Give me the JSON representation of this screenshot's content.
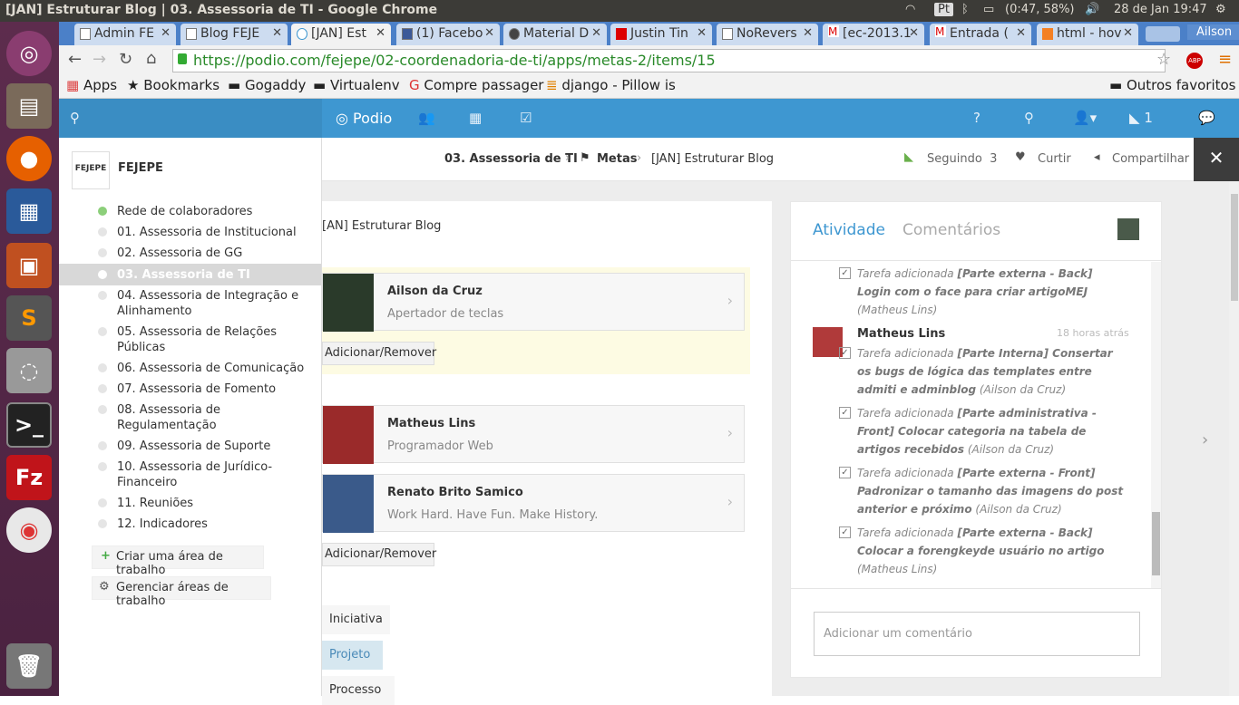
{
  "os": {
    "window_title": "[JAN] Estruturar Blog | 03. Assessoria de TI - Google Chrome",
    "keyboard": "Pt",
    "battery": "(0:47, 58%)",
    "datetime": "28 de Jan 19:47",
    "user": "Ailson"
  },
  "tabs": [
    {
      "label": "Admin FE"
    },
    {
      "label": "Blog FEJE"
    },
    {
      "label": "[JAN] Est"
    },
    {
      "label": "(1) Facebo"
    },
    {
      "label": "Material D"
    },
    {
      "label": "Justin Tin"
    },
    {
      "label": "NoRevers"
    },
    {
      "label": "[ec-2013.1"
    },
    {
      "label": "Entrada ("
    },
    {
      "label": "html - hov"
    }
  ],
  "tab_user": "Ailson",
  "url": "https://podio.com/fejepe/02-coordenadoria-de-ti/apps/metas-2/items/15",
  "bookmarks": [
    {
      "label": "Apps"
    },
    {
      "label": "Bookmarks"
    },
    {
      "label": "Gogaddy"
    },
    {
      "label": "Virtualenv"
    },
    {
      "label": "Compre passager"
    },
    {
      "label": "django - Pillow is"
    }
  ],
  "bookmarks_other": "Outros favoritos",
  "podio": {
    "logo": "Podio",
    "notif_count": "1"
  },
  "sidebar": {
    "org_logo": "FEJEPE",
    "org_name": "FEJEPE",
    "items": [
      {
        "label": "Rede de colaboradores"
      },
      {
        "label": "01. Assessoria de Institucional"
      },
      {
        "label": "02. Assessoria de GG"
      },
      {
        "label": "03. Assessoria de TI"
      },
      {
        "label": "04. Assessoria de Integração e Alinhamento"
      },
      {
        "label": "05. Assessoria de Relações Públicas"
      },
      {
        "label": "06. Assessoria de Comunicação"
      },
      {
        "label": "07. Assessoria de Fomento"
      },
      {
        "label": "08. Assessoria de Regulamentação"
      },
      {
        "label": "09. Assessoria de Suporte"
      },
      {
        "label": "10. Assessoria de Jurídico-Financeiro"
      },
      {
        "label": "11. Reuniões"
      },
      {
        "label": "12. Indicadores"
      }
    ],
    "create_workspace": "Criar uma área de trabalho",
    "manage_workspaces": "Gerenciar áreas de trabalho"
  },
  "breadcrumb": {
    "workspace": "03. Assessoria de TI",
    "app": "Metas",
    "item": "[JAN] Estruturar Blog"
  },
  "actions": {
    "following": "Seguindo",
    "following_count": "3",
    "like": "Curtir",
    "share": "Compartilhar"
  },
  "item": {
    "title": "[AN] Estruturar Blog",
    "people_top": [
      {
        "name": "Ailson da Cruz",
        "role": "Apertador de teclas"
      }
    ],
    "people_bottom": [
      {
        "name": "Matheus Lins",
        "role": "Programador Web"
      },
      {
        "name": "Renato Brito Samico",
        "role": "Work Hard. Have Fun. Make History."
      }
    ],
    "add_remove": "Adicionar/Remover",
    "categories": [
      "Iniciativa",
      "Projeto",
      "Processo"
    ]
  },
  "activity": {
    "tab_activity": "Atividade",
    "tab_comments": "Comentários",
    "entries": [
      {
        "prefix": "Tarefa adicionada",
        "task": "[Parte externa - Back] Login com o face para criar artigoMEJ",
        "by": "(Matheus Lins)"
      },
      {
        "prefix": "Tarefa adicionada",
        "task": "[Parte Interna] Consertar os bugs de lógica das templates entre admiti e adminblog",
        "by": "(Ailson da Cruz)"
      },
      {
        "prefix": "Tarefa adicionada",
        "task": "[Parte administrativa - Front] Colocar categoria na tabela de artigos recebidos",
        "by": "(Ailson da Cruz)"
      },
      {
        "prefix": "Tarefa adicionada",
        "task": "[Parte externa - Front] Padronizar o tamanho das imagens do post anterior e próximo",
        "by": "(Ailson da Cruz)"
      },
      {
        "prefix": "Tarefa adicionada",
        "task": "[Parte externa - Back] Colocar a forengkeyde usuário no artigo",
        "by": "(Matheus Lins)"
      }
    ],
    "author": "Matheus Lins",
    "time": "18 horas atrás",
    "comment_placeholder": "Adicionar um comentário"
  }
}
